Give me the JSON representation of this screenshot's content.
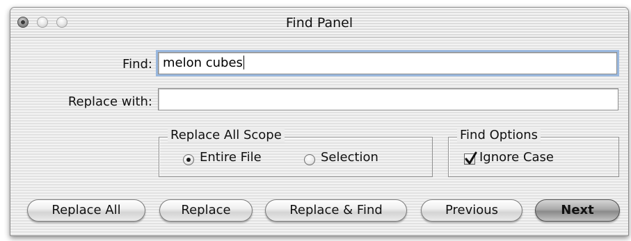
{
  "window": {
    "title": "Find Panel"
  },
  "find": {
    "label": "Find:",
    "value": "melon cubes"
  },
  "replace": {
    "label": "Replace with:",
    "value": ""
  },
  "scope": {
    "title": "Replace All Scope",
    "options": [
      {
        "label": "Entire File",
        "selected": true
      },
      {
        "label": "Selection",
        "selected": false
      }
    ]
  },
  "find_options": {
    "title": "Find Options",
    "ignore_case_label": "Ignore Case",
    "ignore_case_checked": true
  },
  "buttons": {
    "replace_all": "Replace All",
    "replace": "Replace",
    "replace_and_find": "Replace & Find",
    "previous": "Previous",
    "next": "Next"
  }
}
